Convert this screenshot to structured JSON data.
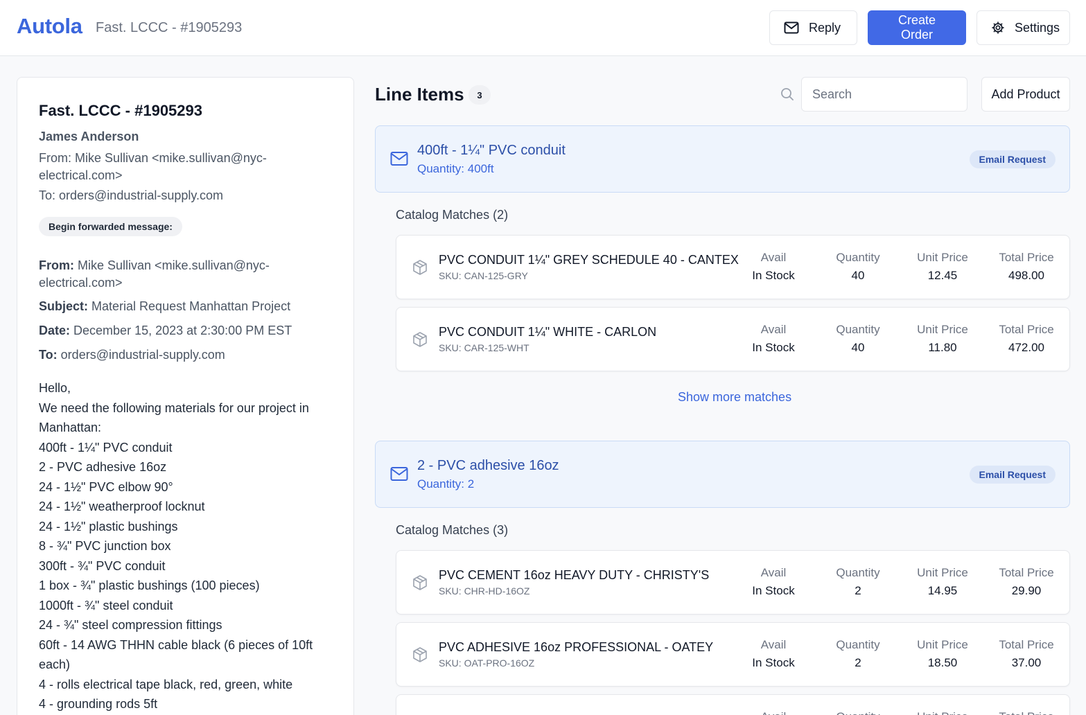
{
  "header": {
    "logo": "Autola",
    "breadcrumb": "Fast. LCCC - #1905293",
    "reply_label": "Reply",
    "create_order_label": "Create Order",
    "settings_label": "Settings"
  },
  "email": {
    "title": "Fast. LCCC - #1905293",
    "sender_name": "James Anderson",
    "from_line": "From: Mike Sullivan <mike.sullivan@nyc-electrical.com>",
    "to_line": "To: orders@industrial-supply.com",
    "forward_badge": "Begin forwarded message:",
    "meta": {
      "from_label": "From:",
      "from_value": "Mike Sullivan <mike.sullivan@nyc-electrical.com>",
      "subject_label": "Subject:",
      "subject_value": "Material Request Manhattan Project",
      "date_label": "Date:",
      "date_value": "December 15, 2023 at 2:30:00 PM EST",
      "to_label": "To:",
      "to_value": "orders@industrial-supply.com"
    },
    "body_lines": [
      "Hello,",
      "We need the following materials for our project in",
      "Manhattan:",
      "400ft - 1¼\" PVC conduit",
      "2 - PVC adhesive 16oz",
      "24 - 1½\" PVC elbow 90°",
      "24 - 1½\" weatherproof locknut",
      "24 - 1½\" plastic bushings",
      "8 - ¾\" PVC junction box",
      "300ft - ¾\" PVC conduit",
      "1 box - ¾\" plastic bushings (100 pieces)",
      "1000ft - ¾\" steel conduit",
      "24 - ¾\" steel compression fittings",
      "60ft - 14 AWG THHN cable black (6 pieces of 10ft",
      "each)",
      "4 - rolls electrical tape black, red, green, white",
      "4 - grounding rods 5ft"
    ]
  },
  "line_items": {
    "title": "Line Items",
    "count": "3",
    "search_placeholder": "Search",
    "add_product_label": "Add Product",
    "show_more_label": "Show more matches",
    "col_headers": {
      "avail": "Avail",
      "quantity": "Quantity",
      "unit_price": "Unit Price",
      "total_price": "Total Price"
    },
    "items": [
      {
        "title": "400ft - 1¼\" PVC conduit",
        "quantity": "Quantity: 400ft",
        "badge": "Email Request",
        "matches_label": "Catalog Matches (2)",
        "matches": [
          {
            "name": "PVC CONDUIT 1¼\" GREY SCHEDULE 40 - CANTEX",
            "sku": "SKU: CAN-125-GRY",
            "avail": "In Stock",
            "quantity": "40",
            "unit_price": "12.45",
            "total_price": "498.00"
          },
          {
            "name": "PVC CONDUIT 1¼\" WHITE - CARLON",
            "sku": "SKU: CAR-125-WHT",
            "avail": "In Stock",
            "quantity": "40",
            "unit_price": "11.80",
            "total_price": "472.00"
          }
        ]
      },
      {
        "title": "2 - PVC adhesive 16oz",
        "quantity": "Quantity: 2",
        "badge": "Email Request",
        "matches_label": "Catalog Matches (3)",
        "matches": [
          {
            "name": "PVC CEMENT 16oz HEAVY DUTY - CHRISTY'S",
            "sku": "SKU: CHR-HD-16OZ",
            "avail": "In Stock",
            "quantity": "2",
            "unit_price": "14.95",
            "total_price": "29.90"
          },
          {
            "name": "PVC ADHESIVE 16oz PROFESSIONAL - OATEY",
            "sku": "SKU: OAT-PRO-16OZ",
            "avail": "In Stock",
            "quantity": "2",
            "unit_price": "18.50",
            "total_price": "37.00"
          }
        ]
      }
    ]
  },
  "colors": {
    "accent": "#4169e6",
    "request_bg": "#eef4fd",
    "request_text": "#2c4fa8"
  }
}
